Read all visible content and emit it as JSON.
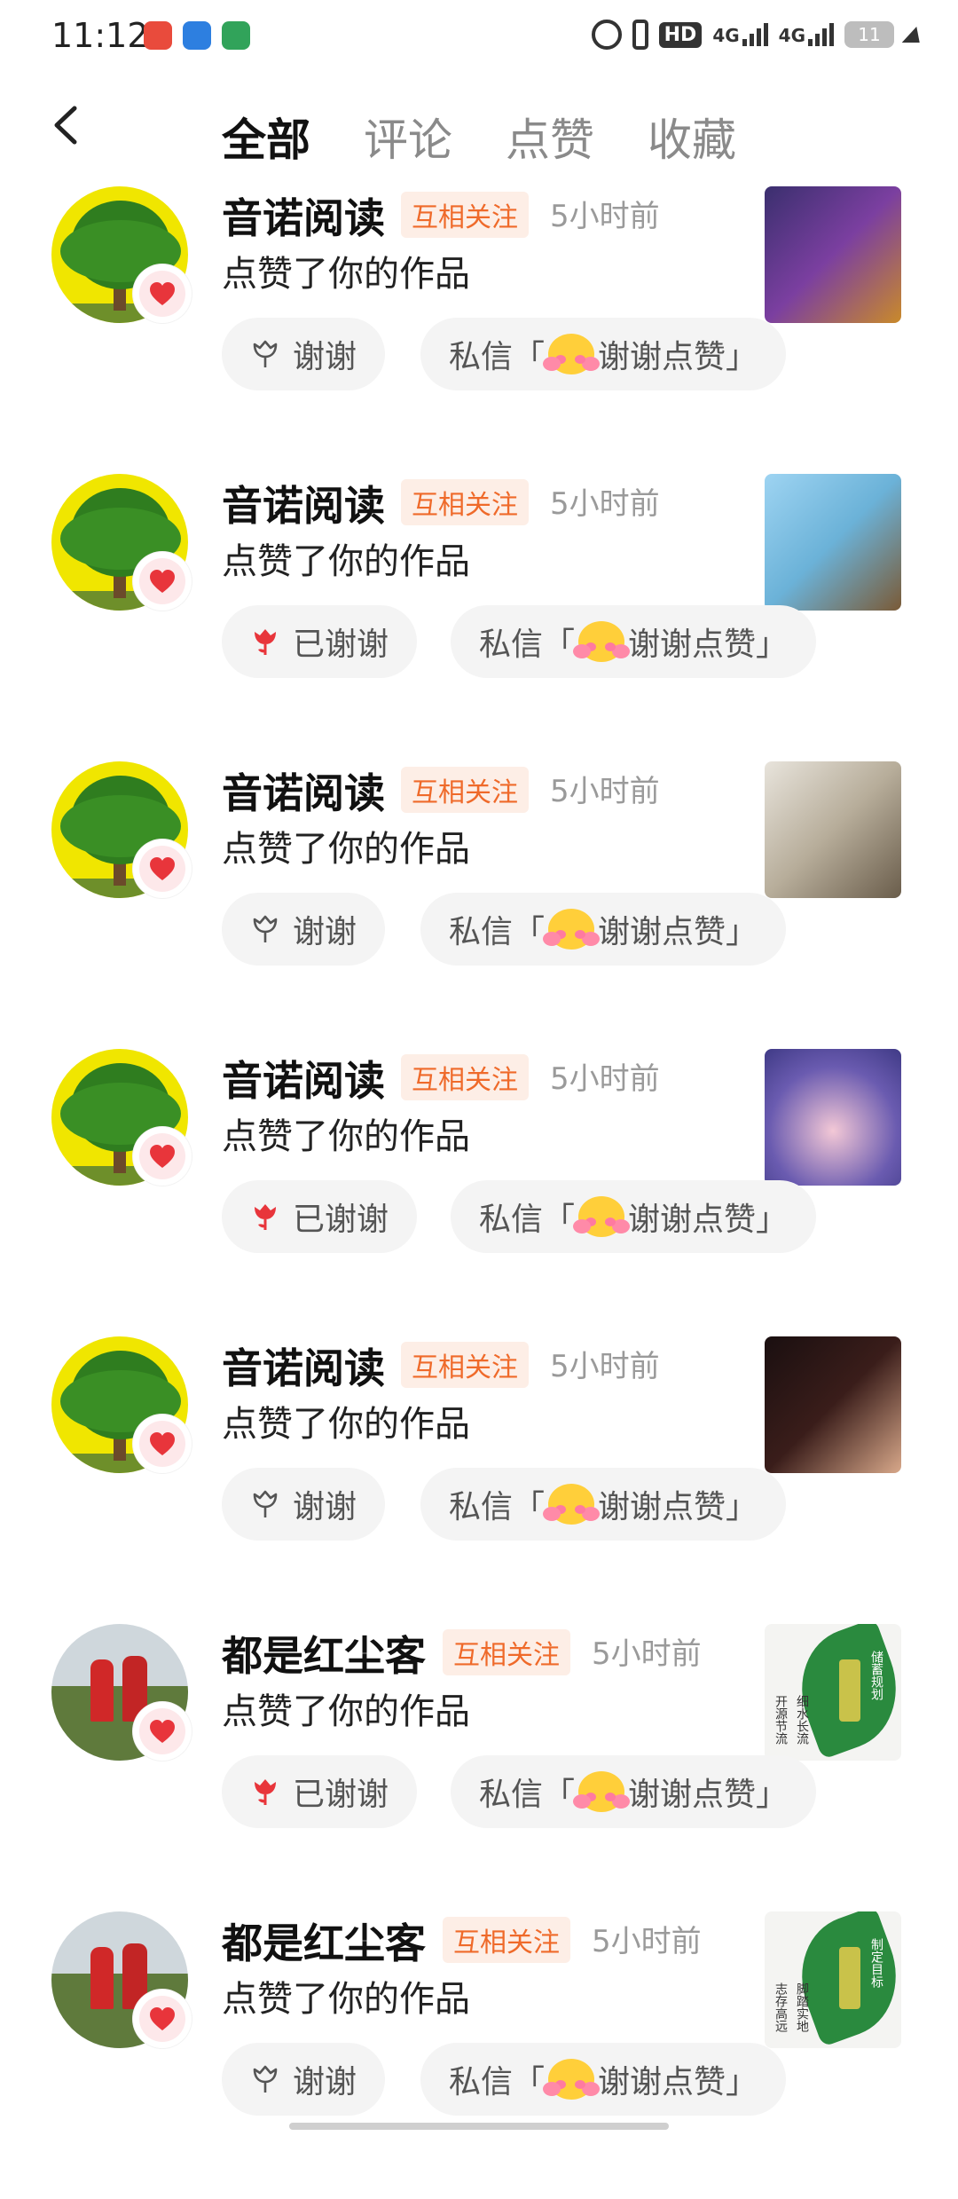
{
  "status_bar": {
    "time": "11:12",
    "hd": "HD",
    "net1": "4G",
    "net2": "4G",
    "battery": "11"
  },
  "header": {
    "tabs": [
      {
        "label": "全部",
        "active": true
      },
      {
        "label": "评论",
        "active": false
      },
      {
        "label": "点赞",
        "active": false
      },
      {
        "label": "收藏",
        "active": false
      }
    ]
  },
  "colors": {
    "accent": "#ef6a2a",
    "heart": "#e8353b",
    "button_bg": "#f4f4f4"
  },
  "notifications": [
    {
      "user": "音诺阅读",
      "badge": "互相关注",
      "time": "5小时前",
      "action": "点赞了你的作品",
      "thank_label": "谢谢",
      "thanked": false,
      "dm_prefix": "私信「",
      "dm_text": "谢谢点赞」",
      "avatar": "tree-avatar",
      "thumb": "robot-thumbnail"
    },
    {
      "user": "音诺阅读",
      "badge": "互相关注",
      "time": "5小时前",
      "action": "点赞了你的作品",
      "thank_label": "已谢谢",
      "thanked": true,
      "dm_prefix": "私信「",
      "dm_text": "谢谢点赞」",
      "avatar": "tree-avatar",
      "thumb": "bird-thumbnail"
    },
    {
      "user": "音诺阅读",
      "badge": "互相关注",
      "time": "5小时前",
      "action": "点赞了你的作品",
      "thank_label": "谢谢",
      "thanked": false,
      "dm_prefix": "私信「",
      "dm_text": "谢谢点赞」",
      "avatar": "tree-avatar",
      "thumb": "shoe-shop-thumbnail"
    },
    {
      "user": "音诺阅读",
      "badge": "互相关注",
      "time": "5小时前",
      "action": "点赞了你的作品",
      "thank_label": "已谢谢",
      "thanked": true,
      "dm_prefix": "私信「",
      "dm_text": "谢谢点赞」",
      "avatar": "tree-avatar",
      "thumb": "sleeping-girl-thumbnail"
    },
    {
      "user": "音诺阅读",
      "badge": "互相关注",
      "time": "5小时前",
      "action": "点赞了你的作品",
      "thank_label": "谢谢",
      "thanked": false,
      "dm_prefix": "私信「",
      "dm_text": "谢谢点赞」",
      "avatar": "tree-avatar",
      "thumb": "mother-child-thumbnail"
    },
    {
      "user": "都是红尘客",
      "badge": "互相关注",
      "time": "5小时前",
      "action": "点赞了你的作品",
      "thank_label": "已谢谢",
      "thanked": true,
      "dm_prefix": "私信「",
      "dm_text": "谢谢点赞」",
      "avatar": "people-avatar",
      "thumb": "leaf-poster-thumbnail",
      "thumb_text": [
        "储蓄规划",
        "开源节流",
        "细水长流"
      ]
    },
    {
      "user": "都是红尘客",
      "badge": "互相关注",
      "time": "5小时前",
      "action": "点赞了你的作品",
      "thank_label": "谢谢",
      "thanked": false,
      "dm_prefix": "私信「",
      "dm_text": "谢谢点赞」",
      "avatar": "people-avatar",
      "thumb": "leaf-poster-thumbnail",
      "thumb_text": [
        "制定目标",
        "志存高远",
        "脚踏实地"
      ]
    }
  ]
}
